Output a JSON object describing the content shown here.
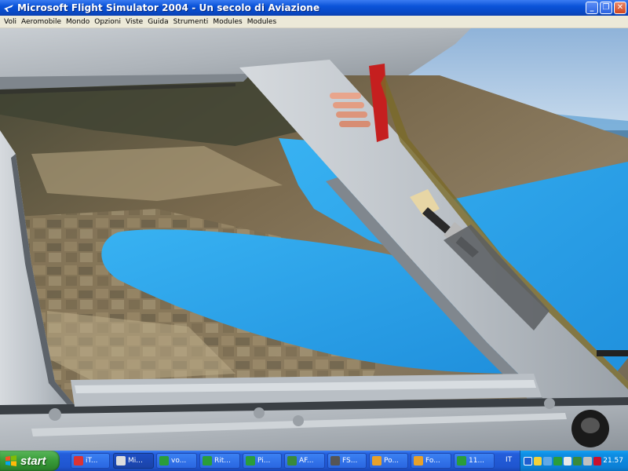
{
  "window": {
    "title": "Microsoft Flight Simulator 2004 - Un secolo di Aviazione",
    "minimize_icon": "minimize-icon",
    "maximize_icon": "restore-icon",
    "close_icon": "close-icon"
  },
  "menu": {
    "items": [
      "Voli",
      "Aeromobile",
      "Mondo",
      "Opzioni",
      "Viste",
      "Guida",
      "Strumenti",
      "Modules",
      "Modules"
    ]
  },
  "scene": {
    "description_icon": "cockpit-view",
    "water_color": "#2aa3ea",
    "sky_color": "#a9c6e2"
  },
  "taskbar": {
    "start_label": "start",
    "tasks": [
      {
        "label": "iT...",
        "icon_color": "#d33",
        "active": false
      },
      {
        "label": "Mi...",
        "icon_color": "#ddd",
        "active": true
      },
      {
        "label": "vo...",
        "icon_color": "#2a9d3a",
        "active": false
      },
      {
        "label": "Rit...",
        "icon_color": "#2a9d3a",
        "active": false
      },
      {
        "label": "Pi...",
        "icon_color": "#2a9d3a",
        "active": false
      },
      {
        "label": "AF...",
        "icon_color": "#3a8a3a",
        "active": false
      },
      {
        "label": "FS...",
        "icon_color": "#555",
        "active": false
      },
      {
        "label": "Po...",
        "icon_color": "#e8a12a",
        "active": false
      },
      {
        "label": "Fo...",
        "icon_color": "#e8a12a",
        "active": false
      },
      {
        "label": "11...",
        "icon_color": "#2a9d3a",
        "active": false
      }
    ],
    "language": "IT",
    "clock": "21.57"
  }
}
